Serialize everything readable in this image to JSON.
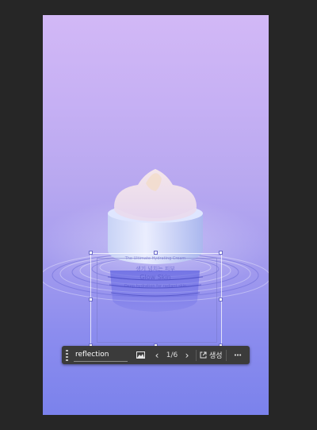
{
  "toolbar": {
    "layer_name": "reflection",
    "page_indicator": "1/6",
    "generate_label": "생성",
    "prev_label": "‹",
    "next_label": "›",
    "more_label": "•••"
  },
  "colors": {
    "app_background": "#262626",
    "toolbar_background": "#3b3b3b",
    "canvas_top": "#d2b8f6",
    "canvas_bottom": "#7b82ec"
  },
  "icons": [
    "drag-grip-icon",
    "image-layer-icon",
    "chevron-left-icon",
    "chevron-right-icon",
    "external-link-icon",
    "more-icon"
  ],
  "reflection_text": {
    "line1": "The Ultimate Hydrating Cream",
    "line2": "생기 넘치는 피부",
    "line3": "Glow Skin",
    "line4": "Deep hydration for radiant skin"
  }
}
